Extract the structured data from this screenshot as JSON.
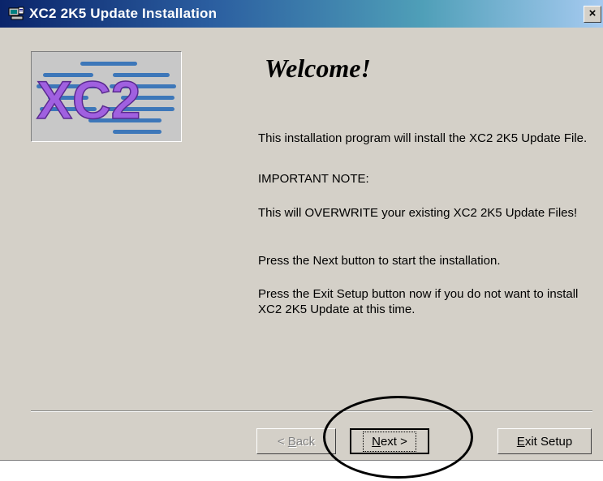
{
  "window": {
    "title": "XC2 2K5 Update Installation",
    "close_glyph": "×"
  },
  "logo": {
    "text": "XC2"
  },
  "content": {
    "heading": "Welcome!",
    "paragraphs": [
      "This installation program will install the XC2 2K5 Update File.",
      "IMPORTANT NOTE:",
      "This will OVERWRITE your existing XC2 2K5 Update Files!",
      "Press the Next button to start the installation.",
      "Press the Exit Setup button now if you do not want to install XC2 2K5 Update at this time."
    ]
  },
  "buttons": {
    "back": {
      "pre": "< ",
      "accel": "B",
      "post": "ack",
      "enabled": false
    },
    "next": {
      "pre": "",
      "accel": "N",
      "post": "ext >",
      "default": true
    },
    "exit": {
      "pre": "",
      "accel": "E",
      "post": "xit Setup"
    }
  },
  "colors": {
    "dialog_face": "#d4d0c8",
    "title_gradient_start": "#0a246a",
    "title_gradient_end": "#a6caf0",
    "logo_purple": "#9b59d6",
    "logo_blue": "#3a7fc2"
  },
  "icons": {
    "app": "installer-computer-icon",
    "close": "close-icon"
  }
}
